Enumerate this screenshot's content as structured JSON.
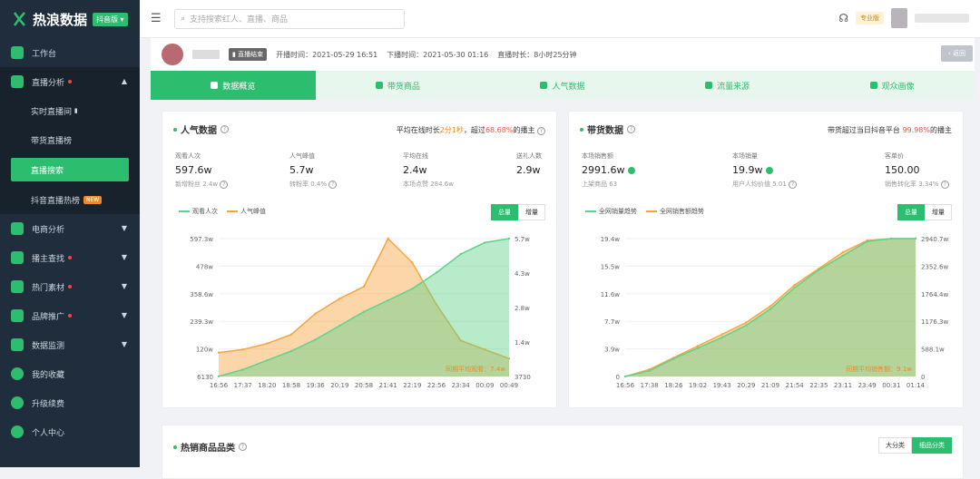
{
  "app": {
    "logo": "热浪数据",
    "edition": "抖音版"
  },
  "sidebar": {
    "items": [
      {
        "label": "工作台"
      },
      {
        "label": "直播分析",
        "open": true
      },
      {
        "label": "实时直播间"
      },
      {
        "label": "带货直播榜"
      },
      {
        "label": "直播搜索",
        "active": true
      },
      {
        "label": "抖音直播热榜",
        "badge": "NEW"
      },
      {
        "label": "电商分析"
      },
      {
        "label": "播主查找"
      },
      {
        "label": "热门素材"
      },
      {
        "label": "品牌推广"
      },
      {
        "label": "数据监测"
      },
      {
        "label": "我的收藏"
      },
      {
        "label": "升级续费"
      },
      {
        "label": "个人中心"
      }
    ]
  },
  "topbar": {
    "search_placeholder": "支持搜索红人、直播、商品",
    "plan": "专业版"
  },
  "host": {
    "status": "直播结束",
    "start": "开播时间：2021-05-29 16:51",
    "end": "下播时间：2021-05-30 01:16",
    "duration": "直播时长：8小时25分钟",
    "back": "返回"
  },
  "tabs": [
    {
      "label": "数据概览"
    },
    {
      "label": "带货商品"
    },
    {
      "label": "人气数据"
    },
    {
      "label": "流量来源"
    },
    {
      "label": "观众画像"
    }
  ],
  "popularity": {
    "title": "人气数据",
    "note_pre": "平均在线时长",
    "note_val": "2分1秒",
    "note_mid": "，超过",
    "note_pct": "68.68%",
    "note_post": "的播主",
    "stats": [
      {
        "label": "观看人次",
        "value": "597.6w",
        "sub": "新增粉丝 2.4w"
      },
      {
        "label": "人气峰值",
        "value": "5.7w",
        "sub": "转粉率 0.4%"
      },
      {
        "label": "平均在线",
        "value": "2.4w",
        "sub": "本场点赞 284.6w"
      },
      {
        "label": "送礼人数",
        "value": "2.9w",
        "sub": ""
      }
    ],
    "legend": [
      "观看人次",
      "人气峰值"
    ],
    "toggle": [
      "总量",
      "增量"
    ],
    "annotation": "同期平均观看：7.4w"
  },
  "sales": {
    "title": "带货数据",
    "note_pre": "带货超过当日抖音平台",
    "note_pct": "99.98%",
    "note_post": "的播主",
    "stats": [
      {
        "label": "本场销售额",
        "value": "2991.6w",
        "sub": "上架商品 63"
      },
      {
        "label": "本场销量",
        "value": "19.9w",
        "sub": "用户人均价值 5.01"
      },
      {
        "label": "客单价",
        "value": "150.00",
        "sub": "销售转化率 3.34%"
      }
    ],
    "legend": [
      "全网销量趋势",
      "全网销售额趋势"
    ],
    "toggle": [
      "总量",
      "增量"
    ],
    "annotation": "同期平均销售额：9.1w"
  },
  "bottom": {
    "title": "热销商品品类",
    "toggle": [
      "大分类",
      "细品分类"
    ]
  },
  "chart_data": [
    {
      "type": "area",
      "title": "人气数据",
      "x": [
        "16:56",
        "17:37",
        "18:20",
        "18:58",
        "19:36",
        "20:19",
        "20:58",
        "21:41",
        "22:19",
        "22:56",
        "23:34",
        "00:09",
        "00:49"
      ],
      "yleft_ticks": [
        "6130",
        "120w",
        "239.3w",
        "358.6w",
        "478w",
        "597.3w"
      ],
      "yright_ticks": [
        "3730",
        "1.4w",
        "2.8w",
        "4.3w",
        "5.7w"
      ],
      "series": [
        {
          "name": "观看人次",
          "axis": "left",
          "values": [
            6130,
            300000,
            700000,
            1100000,
            1600000,
            2200000,
            2800000,
            3300000,
            3800000,
            4500000,
            5300000,
            5800000,
            5973000
          ]
        },
        {
          "name": "人气峰值",
          "axis": "right",
          "values": [
            8000,
            9000,
            11000,
            14000,
            21000,
            26000,
            30000,
            46000,
            38000,
            24000,
            12000,
            9000,
            6000
          ]
        }
      ]
    },
    {
      "type": "area",
      "title": "带货数据",
      "x": [
        "16:56",
        "17:38",
        "18:26",
        "19:02",
        "19:43",
        "20:29",
        "21:09",
        "21:54",
        "22:35",
        "23:11",
        "23:49",
        "00:31",
        "01:14"
      ],
      "yleft_ticks": [
        "0",
        "3.9w",
        "7.7w",
        "11.6w",
        "15.5w",
        "19.4w"
      ],
      "yright_ticks": [
        "0",
        "588.1w",
        "1176.3w",
        "1764.4w",
        "2352.6w",
        "2940.7w"
      ],
      "series": [
        {
          "name": "全网销量趋势",
          "axis": "left",
          "values": [
            0,
            8000,
            25000,
            40000,
            55000,
            72000,
            95000,
            125000,
            150000,
            170000,
            190000,
            194000,
            194000
          ]
        },
        {
          "name": "全网销售额趋势",
          "axis": "right",
          "values": [
            0,
            150,
            400,
            650,
            900,
            1150,
            1500,
            1950,
            2300,
            2650,
            2900,
            2940,
            2940
          ]
        }
      ]
    }
  ]
}
